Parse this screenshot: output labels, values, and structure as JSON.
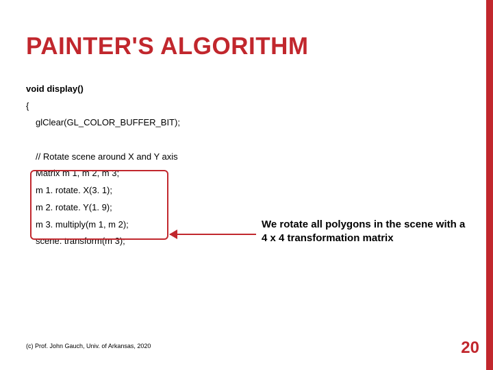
{
  "title": "PAINTER'S ALGORITHM",
  "code": {
    "sig": "void display()",
    "open": "{",
    "l1": "glClear(GL_COLOR_BUFFER_BIT);",
    "blank": " ",
    "l2": "// Rotate scene around X and Y axis",
    "l3": "Matrix m 1, m 2, m 3;",
    "l4": "m 1. rotate. X(3. 1);",
    "l5": "m 2. rotate. Y(1. 9);",
    "l6": "m 3. multiply(m 1, m 2);",
    "l7": "scene. transform(m 3);"
  },
  "annotation": "We rotate all polygons in the scene with a 4 x 4 transformation matrix",
  "footer": "(c) Prof. John Gauch, Univ. of Arkansas, 2020",
  "page": "20"
}
